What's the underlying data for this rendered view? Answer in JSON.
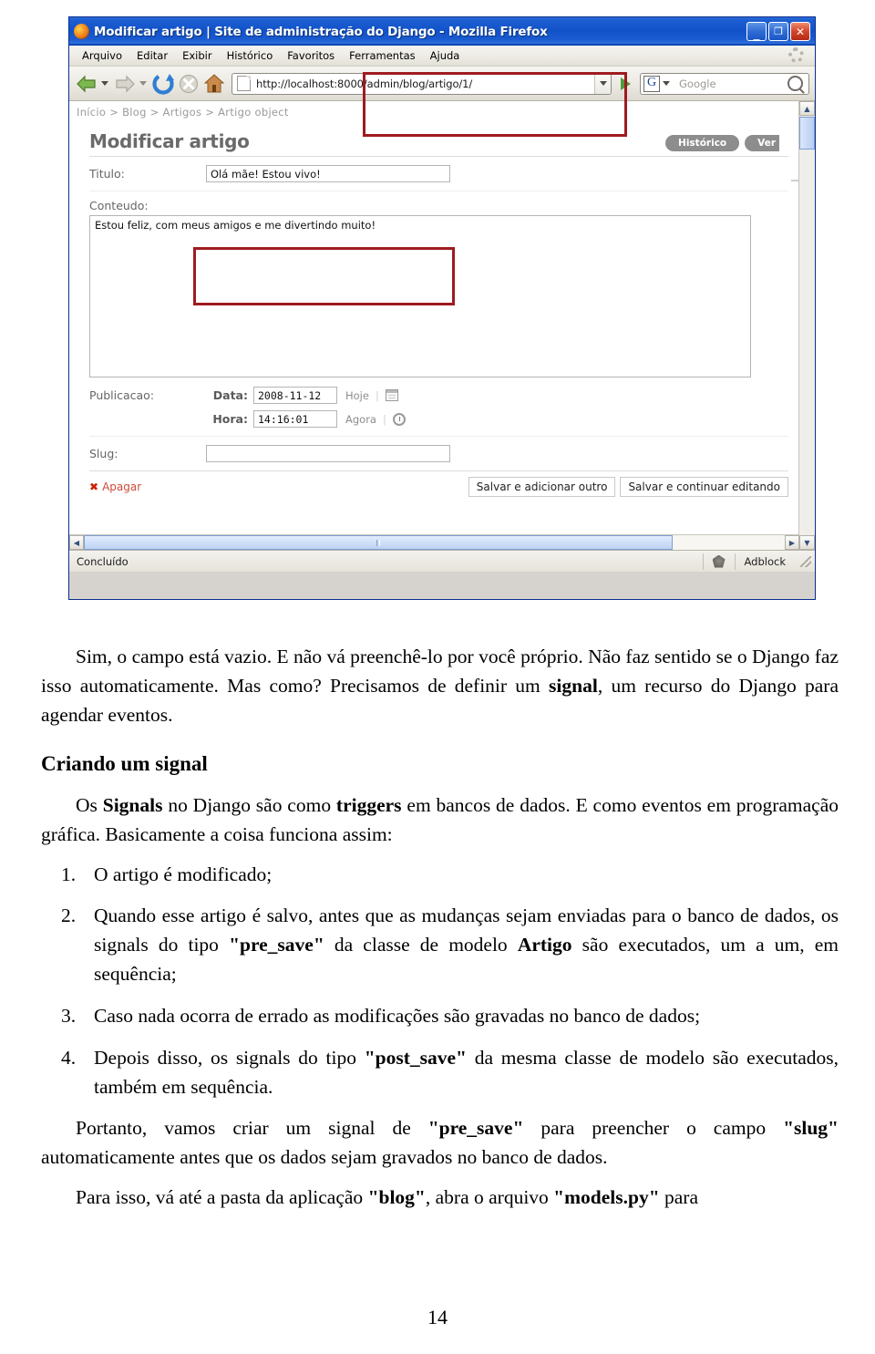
{
  "browser": {
    "title": "Modificar artigo | Site de administração do Django - Mozilla Firefox",
    "window_buttons": {
      "minimize": "_",
      "maximize": "❐",
      "close": "✕"
    },
    "menu": [
      "Arquivo",
      "Editar",
      "Exibir",
      "Histórico",
      "Favoritos",
      "Ferramentas",
      "Ajuda"
    ],
    "toolbar": {
      "back": "back-arrow",
      "forward": "forward-arrow",
      "reload": "reload",
      "stop": "stop",
      "home": "home"
    },
    "url": "http://localhost:8000/admin/blog/artigo/1/",
    "search_engine": "G",
    "search_placeholder": "Google",
    "status": {
      "text": "Concluído",
      "adblock_label": "Adblock"
    }
  },
  "admin": {
    "breadcrumb": "Início > Blog > Artigos > Artigo object",
    "page_title": "Modificar artigo",
    "object_tools": [
      "Histórico",
      "Ver"
    ],
    "fields": {
      "titulo_label": "Titulo:",
      "titulo_value": "Olá mãe! Estou vivo!",
      "conteudo_label": "Conteudo:",
      "conteudo_value": "Estou feliz, com meus amigos e me divertindo muito!",
      "publicacao_label": "Publicacao:",
      "data_label": "Data:",
      "data_value": "2008-11-12",
      "hoje_link": "Hoje",
      "hora_label": "Hora:",
      "hora_value": "14:16:01",
      "agora_link": "Agora",
      "slug_label": "Slug:",
      "slug_value": "",
      "slug_placeholder": ""
    },
    "actions": {
      "delete": "Apagar",
      "save_add_another": "Salvar e adicionar outro",
      "save_continue": "Salvar e continuar editando"
    }
  },
  "annotations": {
    "accent_color": "#9e1b20",
    "boxes": [
      "url-bar",
      "titulo-field",
      "slug-field"
    ]
  },
  "document": {
    "para1_a": "Sim, o campo está vazio. E não vá preenchê-lo por você próprio. Não faz sentido se o Django faz isso automaticamente. Mas como? Precisamos de definir um ",
    "para1_bold": "signal",
    "para1_b": ", um recurso do Django para agendar eventos.",
    "heading": "Criando um signal",
    "para2_a": "Os ",
    "para2_bold1": "Signals",
    "para2_b": " no Django são como ",
    "para2_bold2": "triggers",
    "para2_c": " em bancos de dados. E como eventos em programação gráfica. Basicamente a coisa funciona assim:",
    "item1_num": "1.",
    "item1_text": "O artigo é modificado;",
    "item2_num": "2.",
    "item2_a": "Quando esse artigo é salvo, antes que as mudanças sejam enviadas para o banco de dados, os signals do tipo ",
    "item2_bold1": "\"pre_save\"",
    "item2_b": " da classe de modelo ",
    "item2_bold2": "Artigo",
    "item2_c": " são executados, um a um, em sequência;",
    "item3_num": "3.",
    "item3_text": "Caso nada ocorra de errado as modificações são gravadas no banco de dados;",
    "item4_num": "4.",
    "item4_a": "Depois disso, os signals do tipo ",
    "item4_bold": "\"post_save\"",
    "item4_b": " da mesma classe de modelo são executados, também em sequência.",
    "para3_a": "Portanto, vamos criar um signal de ",
    "para3_bold1": "\"pre_save\"",
    "para3_b": " para preencher o campo ",
    "para3_bold2": "\"slug\"",
    "para3_c": " automaticamente antes que os dados sejam gravados no banco de dados.",
    "para4_a": "Para isso, vá até a pasta da aplicação ",
    "para4_bold1": "\"blog\"",
    "para4_b": ", abra o arquivo ",
    "para4_bold2": "\"models.py\"",
    "para4_c": " para",
    "page_number": "14"
  }
}
